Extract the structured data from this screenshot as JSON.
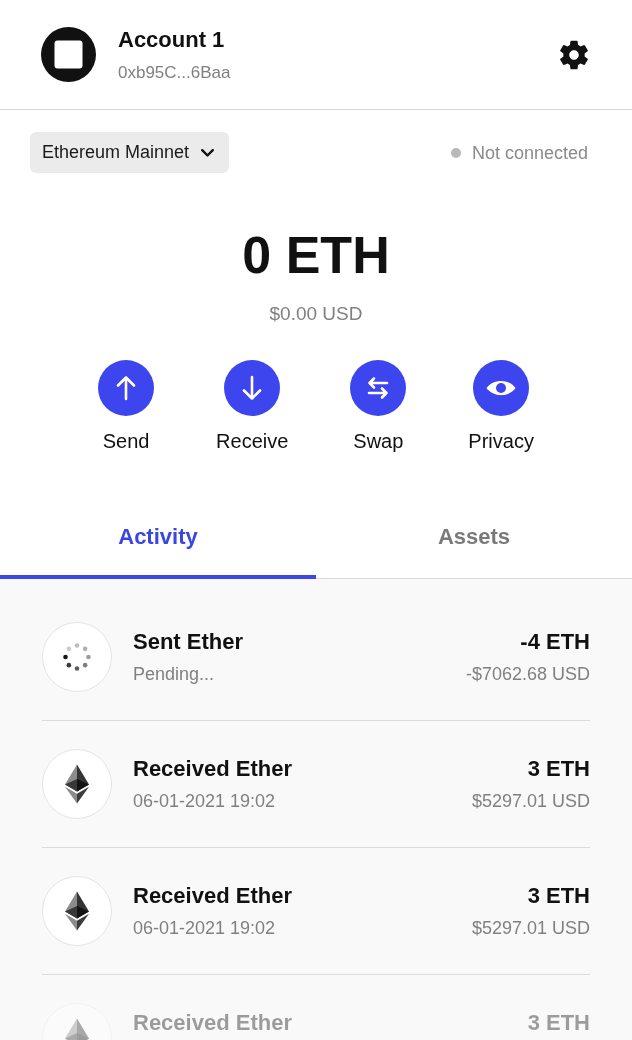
{
  "header": {
    "account_name": "Account 1",
    "address": "0xb95C...6Baa"
  },
  "network": {
    "label": "Ethereum Mainnet",
    "status": "Not connected",
    "connected": false
  },
  "balance": {
    "amount": "0 ETH",
    "fiat": "$0.00 USD"
  },
  "actions": [
    {
      "label": "Send",
      "kind": "send"
    },
    {
      "label": "Receive",
      "kind": "receive"
    },
    {
      "label": "Swap",
      "kind": "swap"
    },
    {
      "label": "Privacy",
      "kind": "privacy"
    }
  ],
  "tabs": [
    {
      "label": "Activity",
      "selected": true
    },
    {
      "label": "Assets",
      "selected": false
    }
  ],
  "activity": [
    {
      "kind": "pending",
      "title": "Sent Ether",
      "subtitle": "Pending...",
      "amount": "-4 ETH",
      "fiat": "-$7062.68 USD"
    },
    {
      "kind": "confirmed",
      "title": "Received Ether",
      "subtitle": "06-01-2021 19:02",
      "amount": "3 ETH",
      "fiat": "$5297.01 USD"
    },
    {
      "kind": "confirmed",
      "title": "Received Ether",
      "subtitle": "06-01-2021 19:02",
      "amount": "3 ETH",
      "fiat": "$5297.01 USD"
    },
    {
      "kind": "confirmed",
      "title": "Received Ether",
      "amount": "3 ETH"
    }
  ]
}
